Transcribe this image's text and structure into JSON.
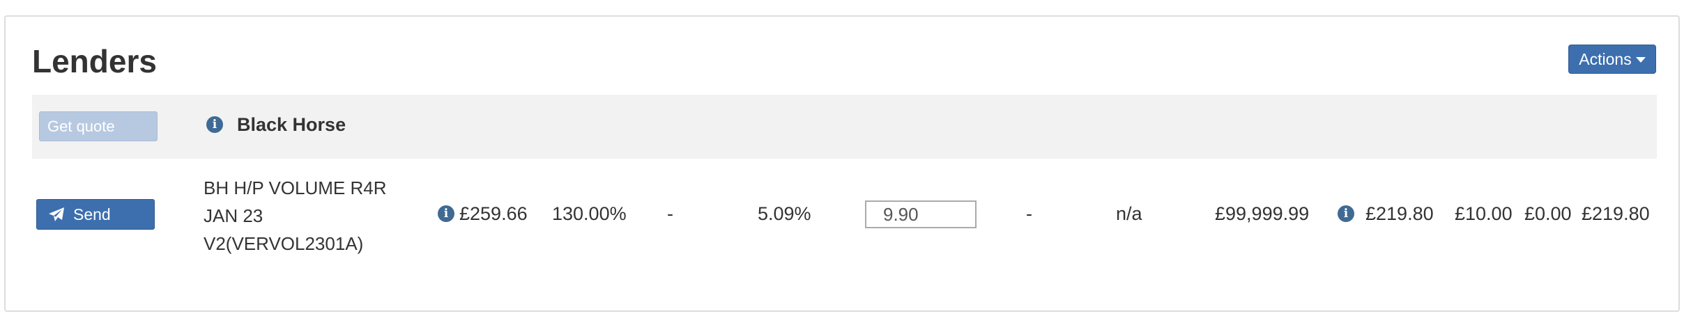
{
  "panel": {
    "title": "Lenders",
    "actions_label": "Actions"
  },
  "header_row": {
    "get_quote_label": "Get quote",
    "lender_name": "Black Horse"
  },
  "quote_row": {
    "send_label": "Send",
    "product_name": "BH H/P VOLUME R4R JAN 23 V2(VERVOL2301A)",
    "monthly_payment": "£259.66",
    "ltv": "130.00%",
    "col_dash_1": "-",
    "apr": "5.09%",
    "fee_value": "9.90",
    "col_dash_2": "-",
    "col_na": "n/a",
    "max_amount": "£99,999.99",
    "total_1": "£219.80",
    "fee_2": "£10.00",
    "fee_3": "£0.00",
    "total_2": "£219.80"
  },
  "colors": {
    "primary_button": "#3d6fae",
    "disabled_button": "#b7c9e1",
    "info_icon": "#3f6a93",
    "header_row_bg": "#f2f2f2"
  },
  "icons": {
    "info": "info-icon",
    "send": "paper-plane-icon",
    "caret": "caret-down-icon"
  }
}
